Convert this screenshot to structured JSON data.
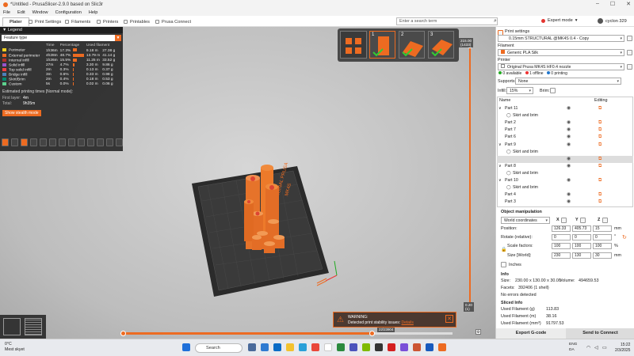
{
  "window": {
    "title": "*Untitled - PrusaSlicer-2.9.0 based on Slic3r",
    "controls": [
      "–",
      "☐",
      "✕"
    ]
  },
  "menu": [
    "File",
    "Edit",
    "Window",
    "Configuration",
    "Help"
  ],
  "tabs": [
    {
      "label": "Plater"
    },
    {
      "label": "Print Settings"
    },
    {
      "label": "Filaments"
    },
    {
      "label": "Printers"
    },
    {
      "label": "Printables"
    },
    {
      "label": "Prusa Connect"
    }
  ],
  "search": {
    "placeholder": "Enter a search term"
  },
  "mode": {
    "label": "Expert mode",
    "color": "#e3342f"
  },
  "user": {
    "name": "cyclon 329"
  },
  "legend": {
    "header": "Legend",
    "view_type": "Feature type",
    "columns": [
      "",
      "Time",
      "Percentage",
      "Used filament"
    ],
    "rows": [
      {
        "name": "Perimeter",
        "color": "#f0d020",
        "time": "1h36m",
        "pct": "17.3%",
        "pct_val": 17.3,
        "len": "9.18 m",
        "weight": "27.38 g"
      },
      {
        "name": "External perimeter",
        "color": "#ed6b21",
        "time": "4h28m",
        "pct": "48.7%",
        "pct_val": 48.7,
        "len": "13.79 m",
        "weight": "41.14 g"
      },
      {
        "name": "Internal infill",
        "color": "#b03029",
        "time": "1h26m",
        "pct": "15.5%",
        "pct_val": 15.5,
        "len": "11.25 m",
        "weight": "33.52 g"
      },
      {
        "name": "Solid infill",
        "color": "#9654cc",
        "time": "27m",
        "pct": "4.7%",
        "pct_val": 4.7,
        "len": "3.30 m",
        "weight": "9.86 g"
      },
      {
        "name": "Top solid infill",
        "color": "#f04040",
        "time": "2m",
        "pct": "0.3%",
        "pct_val": 0.3,
        "len": "0.13 m",
        "weight": "0.37 g"
      },
      {
        "name": "Bridge infill",
        "color": "#4d80ba",
        "time": "3m",
        "pct": "0.6%",
        "pct_val": 0.6,
        "len": "0.33 m",
        "weight": "0.98 g"
      },
      {
        "name": "Skirt/Brim",
        "color": "#00876e",
        "time": "2m",
        "pct": "0.4%",
        "pct_val": 0.4,
        "len": "0.18 m",
        "weight": "0.53 g"
      },
      {
        "name": "Custom",
        "color": "#5ed18e",
        "time": "5s",
        "pct": "0.0%",
        "pct_val": 0.0,
        "len": "0.02 m",
        "weight": "0.06 g"
      }
    ],
    "estimated": "Estimated printing times [Normal mode]:",
    "first_layer_label": "First layer:",
    "first_layer_val": "4m",
    "total_label": "Total:",
    "total_val": "9h35m",
    "stealth_button": "Show stealth mode"
  },
  "plates": [
    "1",
    "2",
    "3"
  ],
  "layer_slider": {
    "top": "215.00\n(1433)",
    "bottom": "0.20\n(1)"
  },
  "h_slider": {
    "label": "22/23904"
  },
  "warning": {
    "title": "WARNING:",
    "text": "Detected print stability issues:",
    "link": "Details"
  },
  "bed": {
    "brand": "ORIGINAL PRUSA",
    "model": "MK4S"
  },
  "panel": {
    "print_settings_label": "Print settings",
    "print_profile": "0.15mm STRUCTURAL @MK4S 0.4 - Copy",
    "filament_label": "Filament",
    "filament_profile": "Generic PLA Silk",
    "filament_color": "#ed6b21",
    "printer_label": "Printer",
    "printer_profile": "Original Prusa MK4S HF0.4 nozzle",
    "status_available": "0 available",
    "status_offline": "1 offline",
    "status_printing": "0 printing",
    "supports_label": "Supports:",
    "supports_value": "None",
    "infill_label": "Infill:",
    "infill_value": "15%",
    "brim_label": "Brim:",
    "obj_header_name": "Name",
    "obj_header_edit": "Editing",
    "objects": [
      {
        "label": "Part 11",
        "type": "group"
      },
      {
        "label": "Skirt and brim",
        "type": "sub"
      },
      {
        "label": "Part 2",
        "type": "item"
      },
      {
        "label": "Part 7",
        "type": "item"
      },
      {
        "label": "Part 6",
        "type": "item"
      },
      {
        "label": "Part 9",
        "type": "group"
      },
      {
        "label": "Skirt and brim",
        "type": "sub"
      },
      {
        "label": "",
        "type": "selected"
      },
      {
        "label": "Part 8",
        "type": "group"
      },
      {
        "label": "Skirt and brim",
        "type": "sub"
      },
      {
        "label": "Part 10",
        "type": "group"
      },
      {
        "label": "Skirt and brim",
        "type": "sub"
      },
      {
        "label": "Part 4",
        "type": "item"
      },
      {
        "label": "Part 3",
        "type": "item"
      }
    ],
    "manip_title": "Object manipulation",
    "coord_system": "World coordinates",
    "axes": [
      "X",
      "Y",
      "Z"
    ],
    "position_label": "Position:",
    "position": [
      "126.33",
      "405.73",
      "15"
    ],
    "position_unit": "mm",
    "rotate_label": "Rotate (relative):",
    "rotate": [
      "0",
      "0",
      "0"
    ],
    "rotate_unit": "°",
    "scale_label": "Scale factors:",
    "scale": [
      "100",
      "100",
      "100"
    ],
    "scale_unit": "%",
    "size_label": "Size [World]:",
    "size": [
      "230",
      "130",
      "30"
    ],
    "size_unit": "mm",
    "inches_label": "Inches",
    "info_title": "Info",
    "info_size_label": "Size:",
    "info_size": "230.00 x 130.00 x 30.00",
    "info_volume_label": "Volume:",
    "info_volume": "494659.53",
    "info_facets_label": "Facets:",
    "info_facets": "392406 (1 shell)",
    "info_errors": "No errors detected",
    "sliced_title": "Sliced Info",
    "sliced": [
      {
        "label": "Used Filament (g)",
        "value": "113.83"
      },
      {
        "label": "Used Filament (m)",
        "value": "38.16"
      },
      {
        "label": "Used Filament (mm³)",
        "value": "91797.53"
      }
    ],
    "export_button": "Export G-code",
    "send_button": "Send to Connect"
  },
  "taskbar": {
    "temp": "0°C",
    "weather": "Mest skyet",
    "search": "Search",
    "lang1": "ENG",
    "lang2": "DA",
    "time": "15:22",
    "date": "2/3/2025"
  }
}
